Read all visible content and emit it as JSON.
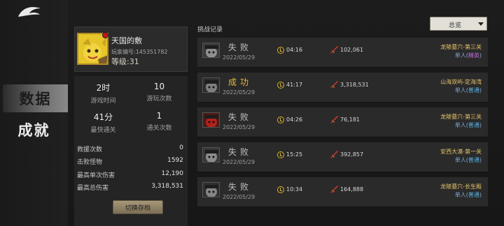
{
  "nav": {
    "items": [
      {
        "label": "数据",
        "active": true
      },
      {
        "label": "成就",
        "active": false
      }
    ]
  },
  "profile": {
    "name": "天国的敷",
    "id_text": "玩家编号:145351782",
    "level_text": "等级:31"
  },
  "stats": {
    "grid": [
      {
        "value": "2时",
        "label": "游戏时间"
      },
      {
        "value": "10",
        "label": "游玩次数"
      },
      {
        "value": "41分",
        "label": "最快通关"
      },
      {
        "value": "1",
        "label": "通关次数"
      }
    ],
    "list": [
      {
        "key": "救援次数",
        "value": "0"
      },
      {
        "key": "击败怪物",
        "value": "1592"
      },
      {
        "key": "最高单次伤害",
        "value": "12,190"
      },
      {
        "key": "最高总伤害",
        "value": "3,318,531"
      }
    ],
    "switch_label": "切换存档"
  },
  "records_header": {
    "title": "挑战记录",
    "filter_value": "总览"
  },
  "records": [
    {
      "result": "失败",
      "success": false,
      "date": "2022/05/29",
      "time": "04:16",
      "damage": "102,061",
      "stage": "龙陵墓穴-第三关",
      "mode_prefix": "单人(",
      "difficulty": "精英",
      "mode_suffix": ")",
      "hard": true
    },
    {
      "result": "成功",
      "success": true,
      "date": "2022/05/29",
      "time": "41:17",
      "damage": "3,318,531",
      "stage": "山海双屿-定海湾",
      "mode_prefix": "单人(",
      "difficulty": "普通",
      "mode_suffix": ")",
      "hard": false
    },
    {
      "result": "失败",
      "success": false,
      "date": "2022/05/29",
      "time": "04:26",
      "damage": "76,181",
      "stage": "龙陵墓穴-第三关",
      "mode_prefix": "单人(",
      "difficulty": "普通",
      "mode_suffix": ")",
      "hard": false
    },
    {
      "result": "失败",
      "success": false,
      "date": "2022/05/29",
      "time": "15:25",
      "damage": "392,857",
      "stage": "安西大漠-第一关",
      "mode_prefix": "单人(",
      "difficulty": "普通",
      "mode_suffix": ")",
      "hard": false
    },
    {
      "result": "失败",
      "success": false,
      "date": "2022/05/29",
      "time": "10:34",
      "damage": "164,888",
      "stage": "龙陵墓穴-长生殿",
      "mode_prefix": "单人(",
      "difficulty": "普通",
      "mode_suffix": ")",
      "hard": false
    }
  ],
  "colors": {
    "fail": "#bfbfbf",
    "success": "#e8b93a",
    "stage": "#e7c46a",
    "hard": "#c06ad8",
    "normal": "#5ab3e8"
  },
  "icons": {
    "logo": "dragon-logo-icon",
    "clock": "clock-icon",
    "damage": "sword-icon",
    "dropdown": "chevron-down-icon"
  }
}
